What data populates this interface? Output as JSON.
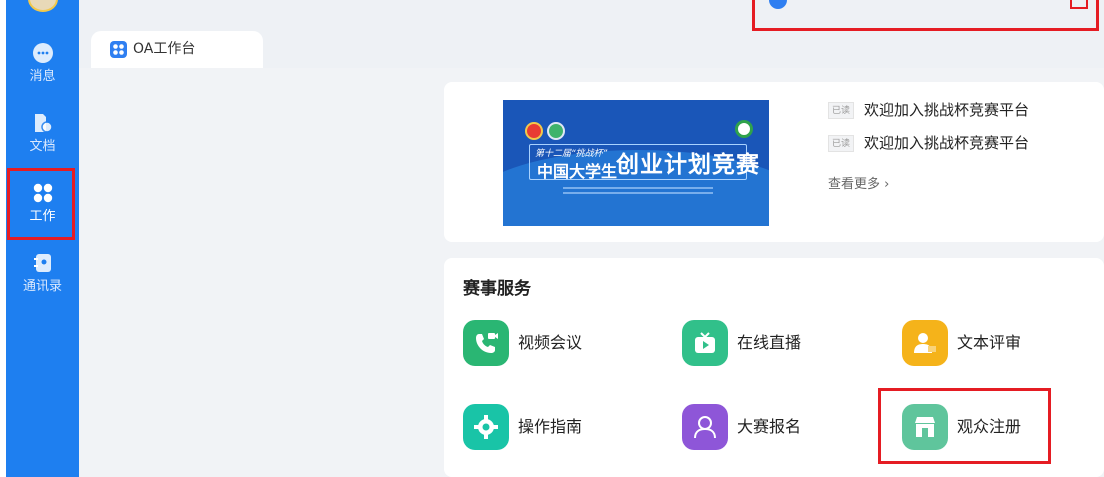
{
  "sidebar": {
    "items": [
      {
        "label": "消息",
        "icon": "chat-icon"
      },
      {
        "label": "文档",
        "icon": "document-icon"
      },
      {
        "label": "工作",
        "icon": "apps-grid-icon"
      },
      {
        "label": "通讯录",
        "icon": "contacts-book-icon"
      }
    ],
    "active": "工作"
  },
  "tab": {
    "label": "OA工作台",
    "icon": "apps-grid-icon"
  },
  "announcements": {
    "items": [
      {
        "tag": "已读",
        "text": "欢迎加入挑战杯竞赛平台"
      },
      {
        "tag": "已读",
        "text": "欢迎加入挑战杯竞赛平台"
      }
    ],
    "more": "查看更多"
  },
  "banner": {
    "line1": "第十二届“挑战杯”",
    "line2": "中国大学生",
    "line3": "创业计划竞赛"
  },
  "services": {
    "title": "赛事服务",
    "items": [
      {
        "label": "视频会议",
        "icon": "video-call-icon",
        "color": "#2ab673"
      },
      {
        "label": "在线直播",
        "icon": "tv-play-icon",
        "color": "#31c08a"
      },
      {
        "label": "文本评审",
        "icon": "reviewer-icon",
        "color": "#f5b31a"
      },
      {
        "label": "操作指南",
        "icon": "gear-icon",
        "color": "#19c4a7"
      },
      {
        "label": "大赛报名",
        "icon": "registrant-icon",
        "color": "#8e56d8"
      },
      {
        "label": "观众注册",
        "icon": "storefront-icon",
        "color": "#5fc59c"
      }
    ]
  },
  "colors": {
    "sidebar": "#1e7ff0",
    "highlight": "#e51c23",
    "background": "#f1f3f6"
  }
}
